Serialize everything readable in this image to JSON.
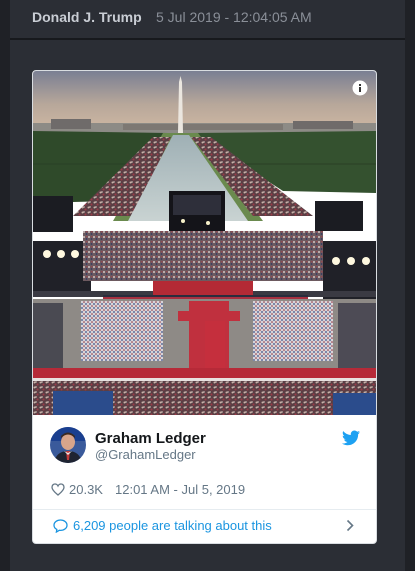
{
  "post": {
    "author": "Donald J. Trump",
    "timestamp": "5 Jul 2019 - 12:04:05 AM"
  },
  "tweet": {
    "photo_icon": "photo",
    "info_icon": "info-icon",
    "user": {
      "name": "Graham Ledger",
      "handle": "@GrahamLedger",
      "avatar_icon": "avatar"
    },
    "brand_icon": "twitter-bird-icon",
    "likes": "20.3K",
    "time": "12:01 AM - Jul 5, 2019",
    "talking": "6,209 people are talking about this"
  },
  "colors": {
    "background": "#1f2126",
    "panel": "#2b2e35",
    "link": "#1b95e0",
    "twitter_blue": "#1da1f2"
  }
}
